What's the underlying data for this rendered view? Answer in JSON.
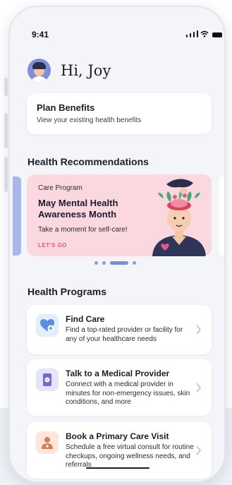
{
  "status": {
    "time": "9:41"
  },
  "greeting": {
    "text": "Hi, Joy"
  },
  "plan": {
    "title": "Plan Benefits",
    "subtitle": "View your existing health benefits"
  },
  "recommendations": {
    "section_title": "Health Recommendations",
    "banner": {
      "kicker": "Care Program",
      "title": "May Mental Health Awareness Month",
      "subtitle": "Take a moment for self-care!",
      "cta": "LET'S GO",
      "background": "#fbd8df",
      "cta_color": "#e25a86"
    },
    "carousel": {
      "active_index": 2,
      "count": 4
    }
  },
  "programs": {
    "section_title": "Health Programs",
    "items": [
      {
        "title": "Find Care",
        "description": "Find a top-rated provider or facility for any of your healthcare needs",
        "icon": "heart-plus-icon",
        "icon_bg": "#e3eefb"
      },
      {
        "title": "Talk to a Medical Provider",
        "description": "Connect with a medical provider in minutes for non-emergency issues, skin conditions, and more",
        "icon": "video-phone-icon",
        "icon_bg": "#e6e4f8"
      },
      {
        "title": "Book a Primary Care Visit",
        "description": "Schedule a free virtual consult for routine checkups, ongoing wellness needs, and referrals",
        "icon": "doctor-icon",
        "icon_bg": "#fde7dc"
      }
    ]
  },
  "colors": {
    "accent": "#7e8bd8",
    "text": "#1b1d2a"
  }
}
